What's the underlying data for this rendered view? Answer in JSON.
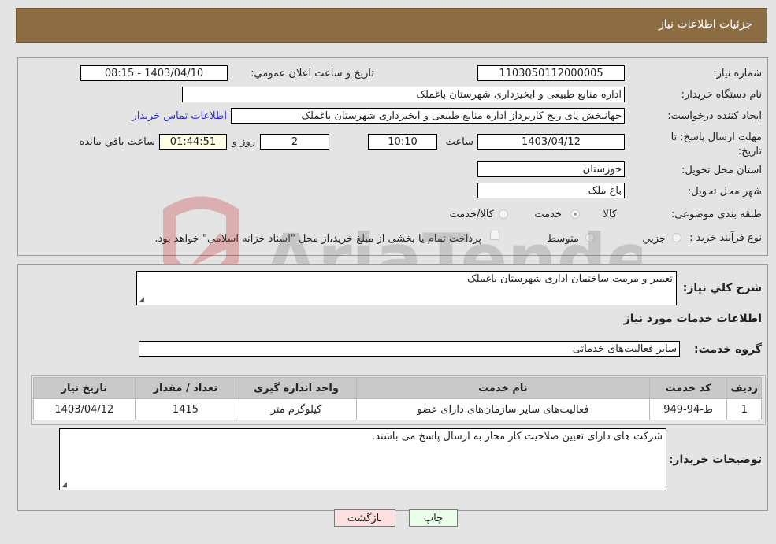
{
  "header": {
    "title": "جزئیات اطلاعات نیاز"
  },
  "fields": {
    "need_number": {
      "label": "شماره نیاز:",
      "value": "1103050112000005"
    },
    "announce_datetime": {
      "label": "تاریخ و ساعت اعلان عمومي:",
      "value": "1403/04/10 - 08:15"
    },
    "buyer_org": {
      "label": "نام دستگاه خریدار:",
      "value": "اداره منابع طبیعی و ابخیزداری شهرستان باغملک"
    },
    "requester": {
      "label": "ایجاد کننده درخواست:",
      "value": "جهانبخش پای رنج کاربرداز اداره منابع طبیعی و ابخیزداری شهرستان باغملک"
    },
    "buyer_contact_link": "اطلاعات تماس خریدار",
    "deadline": {
      "label": "مهلت ارسال پاسخ: تا تاریخ:",
      "date": "1403/04/12",
      "time_label": "ساعت",
      "time": "10:10",
      "days": "2",
      "days_label": "روز و",
      "remaining": "01:44:51",
      "remaining_label": "ساعت باقي مانده"
    },
    "province": {
      "label": "استان محل تحویل:",
      "value": "خوزستان"
    },
    "city": {
      "label": "شهر محل تحویل:",
      "value": "باغ ملک"
    },
    "category": {
      "label": "طبقه بندی موضوعی:",
      "options": [
        "کالا",
        "خدمت",
        "کالا/خدمت"
      ],
      "selected": "خدمت"
    },
    "purchase_process": {
      "label": "نوع فرآیند خرید :",
      "options": [
        "جزیي",
        "متوسط"
      ],
      "note": "پرداخت تمام یا بخشی از مبلغ خرید،از محل \"اسناد خزانه اسلامی\" خواهد بود."
    }
  },
  "summary": {
    "label": "شرح کلي نیاز:",
    "value": "تعمیر و مرمت ساختمان اداری شهرستان باغملک"
  },
  "services_section": {
    "title": "اطلاعات خدمات مورد نیاز",
    "group_label": "گروه خدمت:",
    "group_value": "سایر فعالیت‌های خدماتی",
    "table": {
      "headers": [
        "ردیف",
        "کد خدمت",
        "نام خدمت",
        "واحد اندازه گیری",
        "تعداد / مقدار",
        "تاریخ نیاز"
      ],
      "rows": [
        [
          "1",
          "ط-94-949",
          "فعالیت‌های سایر سازمان‌های دارای عضو",
          "کیلوگرم متر",
          "1415",
          "1403/04/12"
        ]
      ]
    }
  },
  "buyer_notes": {
    "label": "توضیحات خریدار:",
    "value": "شرکت های دارای تعیین صلاحیت  کار مجاز به ارسال پاسخ می باشند."
  },
  "buttons": {
    "print": "چاپ",
    "back": "بازگشت"
  },
  "watermark": "AriaTender.net",
  "colors": {
    "header_bg": "#8b6c43",
    "print_bg": "#eaffea",
    "back_bg": "#ffe0e0",
    "link": "#2b2bd1"
  }
}
